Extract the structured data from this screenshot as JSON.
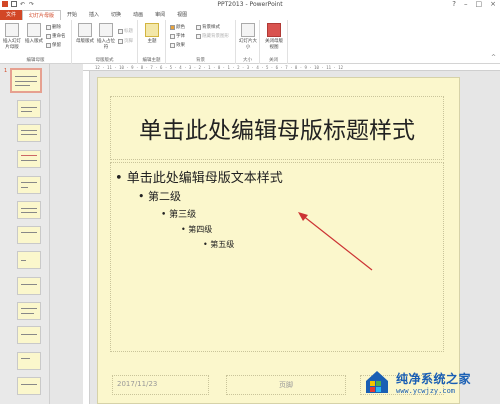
{
  "window": {
    "title": "PPT2013 - PowerPoint"
  },
  "tabs": [
    {
      "label": "文件"
    },
    {
      "label": "幻灯片母版"
    },
    {
      "label": "开始"
    },
    {
      "label": "插入"
    },
    {
      "label": "切换"
    },
    {
      "label": "动画"
    },
    {
      "label": "审阅"
    },
    {
      "label": "视图"
    }
  ],
  "ribbon": {
    "edit_master": {
      "label": "编辑母版",
      "insert_master": "插入幻灯片母版",
      "insert_layout": "插入版式",
      "delete": "删除",
      "rename": "重命名",
      "preserve": "保留"
    },
    "master_layout": {
      "label": "母版版式",
      "master_layout_btn": "母版版式",
      "insert_placeholder": "插入占位符",
      "title": "标题",
      "footer": "页脚"
    },
    "edit_theme": {
      "label": "编辑主题",
      "themes": "主题"
    },
    "background": {
      "label": "背景",
      "colors": "颜色",
      "fonts": "字体",
      "effects": "效果",
      "bg_styles": "背景样式",
      "hide_bg": "隐藏背景图形"
    },
    "size": {
      "label": "大小",
      "slide_size": "幻灯片大小"
    },
    "close": {
      "label": "关闭",
      "close_master": "关闭母版视图"
    }
  },
  "ruler": {
    "top_text": "12 · 11 · 10 · 9 · 8 · 7 · 6 · 5 · 4 · 3 · 2 · 1 · 0 · 1 · 2 · 3 · 4 · 5 · 6 · 7 · 8 · 9 · 10 · 11 · 12"
  },
  "thumbnails": {
    "first_number": "1"
  },
  "slide": {
    "title": "单击此处编辑母版标题样式",
    "body": {
      "level1": "• 单击此处编辑母版文本样式",
      "level2": "• 第二级",
      "level3": "• 第三级",
      "level4": "• 第四级",
      "level5": "• 第五级"
    },
    "footer_date": "2017/11/23",
    "footer_center": "页脚"
  },
  "watermark": {
    "main": "纯净系统之家",
    "sub": "www.ycwjzy.com"
  },
  "colors": {
    "accent": "#d24726",
    "slide_bg": "#fbf7cc",
    "arrow": "#cc3333"
  }
}
